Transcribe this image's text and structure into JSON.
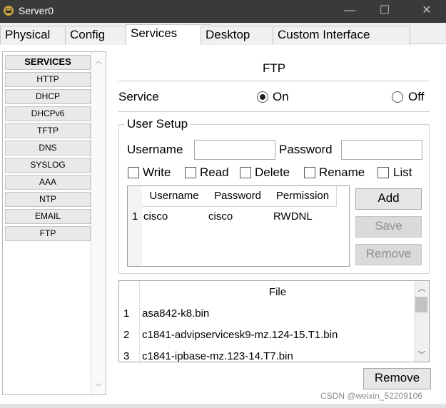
{
  "window": {
    "title": "Server0",
    "minimize": "—",
    "maximize": "☐",
    "close": "✕"
  },
  "tabs": [
    {
      "label": "Physical"
    },
    {
      "label": "Config"
    },
    {
      "label": "Services"
    },
    {
      "label": "Desktop"
    },
    {
      "label": "Custom Interface"
    }
  ],
  "active_tab": "Services",
  "services": {
    "header": "SERVICES",
    "items": [
      "HTTP",
      "DHCP",
      "DHCPv6",
      "TFTP",
      "DNS",
      "SYSLOG",
      "AAA",
      "NTP",
      "EMAIL",
      "FTP"
    ]
  },
  "ftp": {
    "title": "FTP",
    "service_label": "Service",
    "on_label": "On",
    "off_label": "Off",
    "service_state": "On",
    "user_setup": {
      "legend": "User Setup",
      "username_label": "Username",
      "username_value": "",
      "password_label": "Password",
      "password_value": "",
      "permissions": [
        {
          "label": "Write",
          "checked": false
        },
        {
          "label": "Read",
          "checked": false
        },
        {
          "label": "Delete",
          "checked": false
        },
        {
          "label": "Rename",
          "checked": false
        },
        {
          "label": "List",
          "checked": false
        }
      ],
      "table": {
        "columns": [
          "Username",
          "Password",
          "Permission"
        ],
        "rows": [
          {
            "num": "1",
            "username": "cisco",
            "password": "cisco",
            "permission": "RWDNL"
          }
        ]
      },
      "buttons": {
        "add": "Add",
        "save": "Save",
        "remove": "Remove"
      }
    },
    "files": {
      "header": "File",
      "rows": [
        {
          "num": "1",
          "name": "asa842-k8.bin"
        },
        {
          "num": "2",
          "name": "c1841-advipservicesk9-mz.124-15.T1.bin"
        },
        {
          "num": "3",
          "name": "c1841-ipbase-mz.123-14.T7.bin"
        }
      ],
      "remove_button": "Remove"
    }
  },
  "watermark": "CSDN @weixin_52209106",
  "colors": {
    "titlebar": "#3a3a3a",
    "button": "#e6e6e6",
    "disabled_text": "#8f8f8f"
  }
}
